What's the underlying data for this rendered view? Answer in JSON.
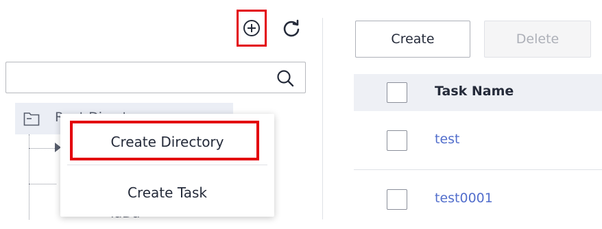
{
  "toolbar": {
    "add_icon": "plus-circle-icon",
    "refresh_icon": "refresh-icon"
  },
  "search": {
    "value": "",
    "icon": "search-icon"
  },
  "tree": {
    "root_label": "Root Directory",
    "child_label": "TaDa",
    "root_icon": "folder-icon"
  },
  "context_menu": {
    "items": [
      {
        "label": "Create Directory"
      },
      {
        "label": "Create Task"
      }
    ]
  },
  "actions": {
    "create_label": "Create",
    "delete_label": "Delete"
  },
  "table": {
    "header": {
      "task_name": "Task Name"
    },
    "rows": [
      {
        "name": "test"
      },
      {
        "name": "test0001"
      }
    ]
  },
  "colors": {
    "highlight": "#e3000b",
    "link": "#526ecc",
    "header_bg": "#eef0f5",
    "selected_row_bg": "#ebeef5"
  }
}
